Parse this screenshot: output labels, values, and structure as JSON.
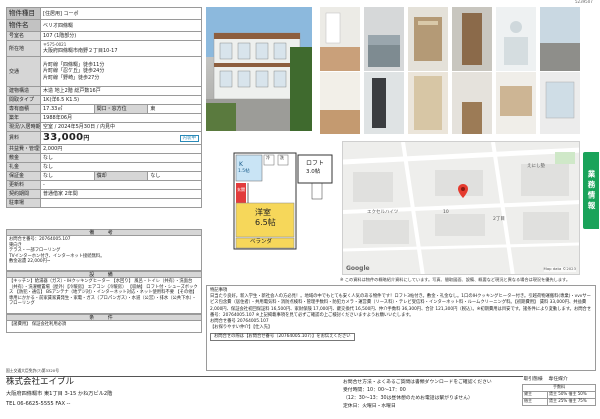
{
  "doc_code": "5239507",
  "spec": {
    "rows": [
      {
        "key": "物件種目",
        "value": "[住居用] コーポ"
      },
      {
        "key": "物件名",
        "value": "ベリオ四條畷"
      },
      {
        "key": "号室名",
        "value": "107 (1階部分)"
      },
      {
        "key": "所在地",
        "value_small": "〒575-0021",
        "value": "大阪府四條畷市南野２丁目10-17"
      },
      {
        "key": "交通",
        "lines": [
          "片町線「四條畷」徒歩11分",
          "片町線「忍ケ丘」徒歩24分",
          "片町線「野崎」徒歩27分"
        ]
      },
      {
        "key": "建物構造",
        "value": "木造 地上2階 総戸数16戸"
      },
      {
        "key": "間取タイプ",
        "value": "1K(洋6.5 K1.5)"
      },
      {
        "key": "専有面積",
        "value": "17.33㎡",
        "key2": "間口・窓方位",
        "value2": "東"
      },
      {
        "key": "築年",
        "value": "1988年06月"
      },
      {
        "key": "現況/入居時期",
        "value": "空室 / 2024年5月30日 / 内見中"
      },
      {
        "key": "賃料",
        "value": "33,000",
        "unit": "円",
        "badge": "内装中"
      },
      {
        "key": "共益費・管理費",
        "value": "2,000円"
      },
      {
        "key": "敷金",
        "value": "なし"
      },
      {
        "key": "礼金",
        "value": "なし"
      },
      {
        "key": "保証金",
        "value": "なし",
        "key2": "償却",
        "value2": "なし"
      },
      {
        "key": "更新料",
        "value": "-"
      },
      {
        "key": "契約期間",
        "value": "普通借家 2年間"
      },
      {
        "key": "駐車場",
        "value": ""
      }
    ]
  },
  "bikou": {
    "heading": "備 考",
    "lines": [
      "お問合せ番号：20764005.107",
      "東向き",
      "テラス・一部フローリング",
      "TVインターホン付き、インターネット接続無料。",
      "敷金返還 22,000円~"
    ]
  },
  "setsubi": {
    "heading": "設 備",
    "text": "【キッチン】給湯器（ガス）・IHクッキングヒーター 【水回り】 風呂・トイレ（共有）・洗面台（共有）・洗濯機置場（屋外）【冷暖房】 エアコン（冷暖房） 【収納】 ロフト付・シューズボックス 【防犯・通信】 BSアンテナ（地デジ対）・インターネット対応・ネット使用料不要 【その他】 専用にかかる・前家賃家賃発生・家電・ガス（プロパンガス）・水道（公営）・排水（公共下水）・フローリング"
  },
  "joken": {
    "heading": "条 件",
    "text": "【諸費用】 保証会社利用必須"
  },
  "floorplan": {
    "kitchen_label": "K",
    "kitchen_size": "1.5帖",
    "loft_label": "ロフト",
    "loft_size": "3.0帖",
    "room_label": "洋室",
    "room_size": "6.5帖",
    "veranda_label": "ベランダ",
    "entrance_label": "玄関",
    "fridge_label": "冷",
    "washer_label": "洗"
  },
  "map": {
    "labels": [
      "えにし塾",
      "エクセルハイツ",
      "2丁目",
      "10"
    ],
    "provider": "Google",
    "copyright": "Map data ©2023"
  },
  "side_tab": "業務情報",
  "note_top": "※ この資料は物件の概略紹介資料にしています。写真、間取図面、設備、概要など現況と異なる場合は現況を優先します。",
  "features": {
    "heading": "特記事項",
    "text": "日当たり良好。新入学生・新社会人の方必見！。地域の中でもとても安く人気のある物件です！ロフト3帖付き。敷金・礼金なし。1口のIHクッキングヒーター付き。引越荷物運搬料(専業)・vvvサービス包含費（居住者）・共用電気料・消防点検料・管理手数料・防犯カメラ・運営費（リース料）・テレビ受信料・インターネット料・ルームクリーニング料。【初期費用】 賃料 33,000円、共益費 2,000円、保証会社初回保証料 16,500円、家財保険 17,000円、鍵交換代 16,500円、仲介手数料 36,300円、合計 121,300円（税込）。※初期費用は目安です。諸条件により変動します。お問合せ番号：20764005.107 ※上記掲載事項を見て必ずご確認の上ご検討くださいますようお願いいたします。",
    "ref_label": "お問合せ番号",
    "ref_value": "20764005.107",
    "keyword": "【お探りやすい仲介】【仕入先】",
    "box": "お問合せの際は【お問合せ番号（20764005.107）】をお伝えください"
  },
  "footer": {
    "license": "国土交通大臣免許(7)第3320号",
    "company": "株式会社エイブル",
    "address": "大阪府四條畷市 東1丁目 3-15 かね万ビル2階",
    "tel": "TEL 06-6625-5555  FAX --",
    "contact": [
      "お問合せ方法・よくあるご質問は書類ダウンロードをご確認ください",
      "受付時間：10：00～17：00",
      "（12：30～13：30は昼休憩のためお電話は繋がりません）",
      "定休日：火曜日・水曜日"
    ],
    "trade": {
      "heading1": "取引態様",
      "heading2": "専任媒介",
      "sub": "手数料",
      "rows": [
        {
          "label": "貸主",
          "value": "賃主 50% 借主 50%"
        },
        {
          "label": "借主",
          "value": "賃主 25% 借主 75%"
        }
      ]
    }
  }
}
